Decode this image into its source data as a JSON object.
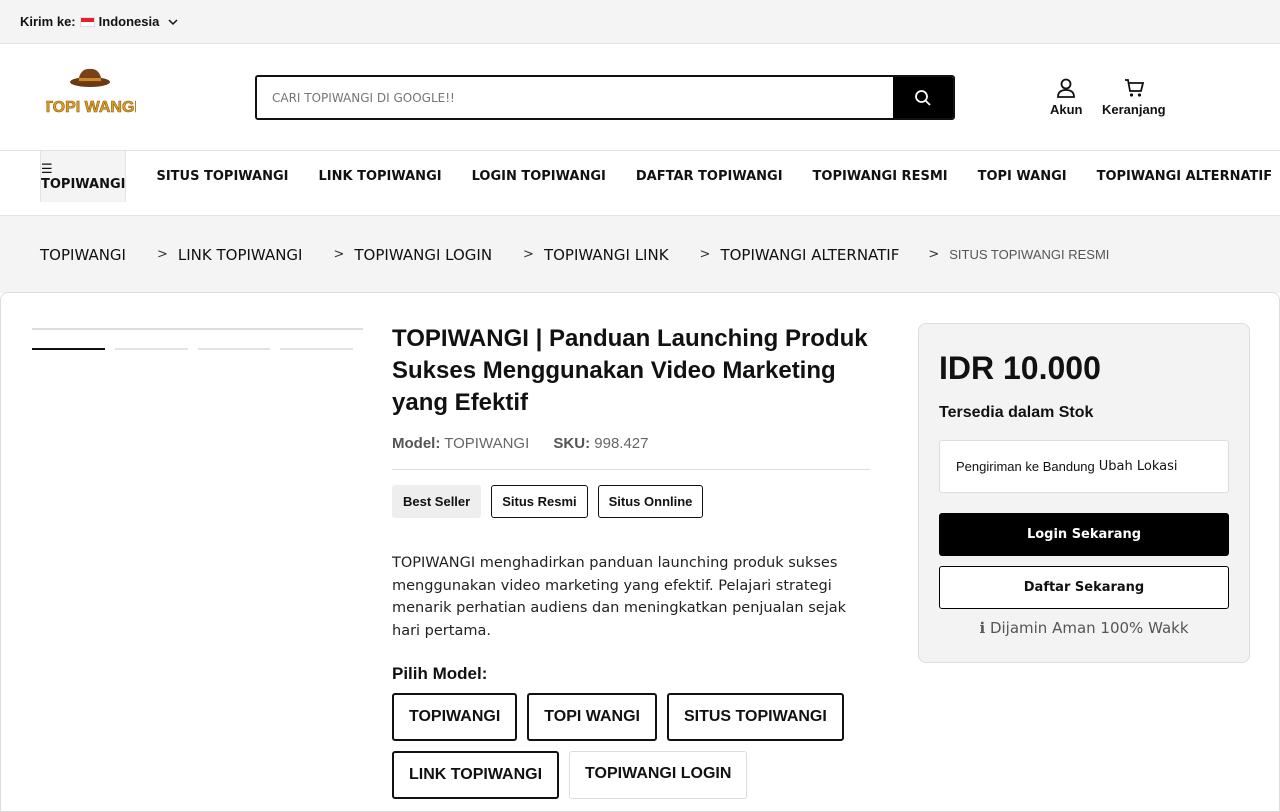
{
  "topbar": {
    "ship_label": "Kirim ke:",
    "country": "Indonesia"
  },
  "header": {
    "logo_text": "TOPI WANGI",
    "search_placeholder": "CARI TOPIWANGI DI GOOGLE!!",
    "account_label": "Akun",
    "cart_label": "Keranjang"
  },
  "nav": {
    "menu_label": "☰ TOPIWANGI",
    "links": [
      "SITUS TOPIWANGI",
      "LINK TOPIWANGI",
      "LOGIN TOPIWANGI",
      "DAFTAR TOPIWANGI",
      "TOPIWANGI RESMI",
      "TOPI WANGI",
      "TOPIWANGI ALTERNATIF"
    ]
  },
  "breadcrumb": {
    "separator": ">",
    "items": [
      "TOPIWANGI",
      "LINK TOPIWANGI",
      "TOPIWANGI LOGIN",
      "TOPIWANGI LINK",
      "TOPIWANGI ALTERNATIF"
    ],
    "current": "SITUS TOPIWANGI RESMI"
  },
  "product": {
    "title": "TOPIWANGI | Panduan Launching Produk Sukses Menggunakan Video Marketing yang Efektif",
    "model_label": "Model:",
    "model_value": "TOPIWANGI",
    "sku_label": "SKU:",
    "sku_value": "998.427",
    "badges": [
      "Best Seller",
      "Situs Resmi",
      "Situs Onnline"
    ],
    "description": "TOPIWANGI menghadirkan panduan launching produk sukses menggunakan video marketing yang efektif. Pelajari strategi menarik perhatian audiens dan meningkatkan penjualan sejak hari pertama.",
    "pick_label": "Pilih Model:",
    "models": [
      "TOPIWANGI",
      "TOPI WANGI",
      "SITUS TOPIWANGI",
      "LINK TOPIWANGI",
      "TOPIWANGI LOGIN"
    ]
  },
  "sidebar": {
    "price": "IDR 10.000",
    "stock": "Tersedia dalam Stok",
    "shipping_text": "Pengiriman ke Bandung",
    "change_location": "Ubah Lokasi",
    "login_button": "Login Sekarang",
    "register_button": "Daftar Sekarang",
    "guarantee": "ℹ Dijamin Aman 100% Wakk"
  }
}
